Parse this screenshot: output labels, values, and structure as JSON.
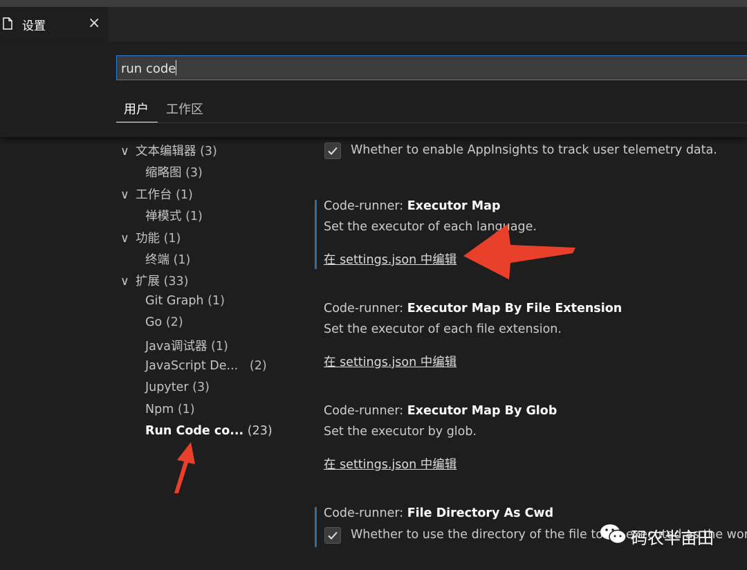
{
  "tab": {
    "title": "设置",
    "close": "×"
  },
  "search": {
    "value": "run code"
  },
  "scopes": {
    "user": "用户",
    "workspace": "工作区"
  },
  "tree": [
    {
      "label": "文本编辑器",
      "count": "(3)",
      "expanded": true
    },
    {
      "label": "缩略图",
      "count": "(3)"
    },
    {
      "label": "工作台",
      "count": "(1)",
      "expanded": true
    },
    {
      "label": "禅模式",
      "count": "(1)"
    },
    {
      "label": "功能",
      "count": "(1)",
      "expanded": true
    },
    {
      "label": "终端",
      "count": "(1)"
    },
    {
      "label": "扩展",
      "count": "(33)",
      "expanded": true
    },
    {
      "label": "Git Graph",
      "count": "(1)"
    },
    {
      "label": "Go",
      "count": "(2)"
    },
    {
      "label": "Java调试器",
      "count": "(1)"
    },
    {
      "label": "JavaScript De...",
      "count": "(2)"
    },
    {
      "label": "Jupyter",
      "count": "(3)"
    },
    {
      "label": "Npm",
      "count": "(1)"
    },
    {
      "label": "Run Code co...",
      "count": "(23)",
      "active": true
    }
  ],
  "settings": {
    "telemetry": {
      "description": "Whether to enable AppInsights to track user telemetry data.",
      "checked": true
    },
    "executor_map": {
      "category": "Code-runner: ",
      "name": "Executor Map",
      "description": "Set the executor of each language.",
      "link": "在 settings.json 中编辑"
    },
    "executor_map_ext": {
      "category": "Code-runner: ",
      "name": "Executor Map By File Extension",
      "description": "Set the executor of each file extension.",
      "link": "在 settings.json 中编辑"
    },
    "executor_map_glob": {
      "category": "Code-runner: ",
      "name": "Executor Map By Glob",
      "description": "Set the executor by glob.",
      "link": "在 settings.json 中编辑"
    },
    "file_dir_cwd": {
      "category": "Code-runner: ",
      "name": "File Directory As Cwd",
      "description": "Whether to use the directory of the file to be executed as the work",
      "checked": true
    }
  },
  "watermark": {
    "text": "码农半亩田"
  },
  "colors": {
    "accent": "#2f7fd1",
    "arrow": "#e8402a",
    "modified_bar": "#2f6ea3"
  }
}
